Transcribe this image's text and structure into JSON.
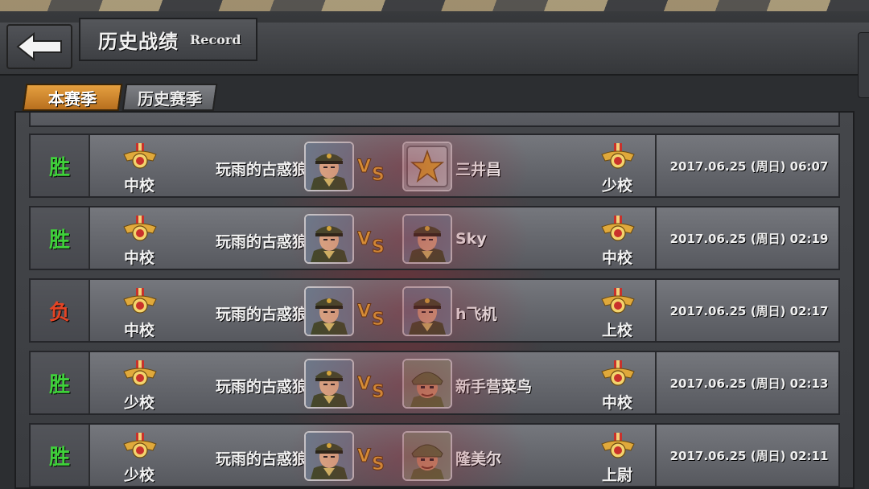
{
  "header": {
    "title_cn": "历史战绩",
    "title_en": "Record"
  },
  "tabs": [
    {
      "label": "本赛季",
      "active": true
    },
    {
      "label": "历史赛季",
      "active": false
    }
  ],
  "vs_label": "VS",
  "colors": {
    "win": "#3fd13a",
    "lose": "#e34425",
    "active_tab": "#e5a040"
  },
  "records": [
    {
      "result": "胜",
      "outcome": "win",
      "my_rank": "中校",
      "my_name": "玩雨的古惑狼",
      "my_avatar": "general-avatar",
      "opponent_name": "三井昌",
      "opponent_avatar": "star-badge-avatar",
      "opponent_rank": "少校",
      "datetime": "2017.06.25 (周日) 06:07"
    },
    {
      "result": "胜",
      "outcome": "win",
      "my_rank": "中校",
      "my_name": "玩雨的古惑狼",
      "my_avatar": "general-avatar",
      "opponent_name": "Sky",
      "opponent_avatar": "general-avatar",
      "opponent_rank": "中校",
      "datetime": "2017.06.25 (周日) 02:19"
    },
    {
      "result": "负",
      "outcome": "lose",
      "my_rank": "中校",
      "my_name": "玩雨的古惑狼",
      "my_avatar": "general-avatar",
      "opponent_name": "h飞机",
      "opponent_avatar": "general-avatar",
      "opponent_rank": "上校",
      "datetime": "2017.06.25 (周日) 02:17"
    },
    {
      "result": "胜",
      "outcome": "win",
      "my_rank": "少校",
      "my_name": "玩雨的古惑狼",
      "my_avatar": "general-avatar",
      "opponent_name": "新手营菜鸟",
      "opponent_avatar": "soldier-avatar",
      "opponent_rank": "中校",
      "datetime": "2017.06.25 (周日) 02:13"
    },
    {
      "result": "胜",
      "outcome": "win",
      "my_rank": "少校",
      "my_name": "玩雨的古惑狼",
      "my_avatar": "general-avatar",
      "opponent_name": "隆美尔",
      "opponent_avatar": "soldier-avatar",
      "opponent_rank": "上尉",
      "datetime": "2017.06.25 (周日) 02:11"
    }
  ]
}
